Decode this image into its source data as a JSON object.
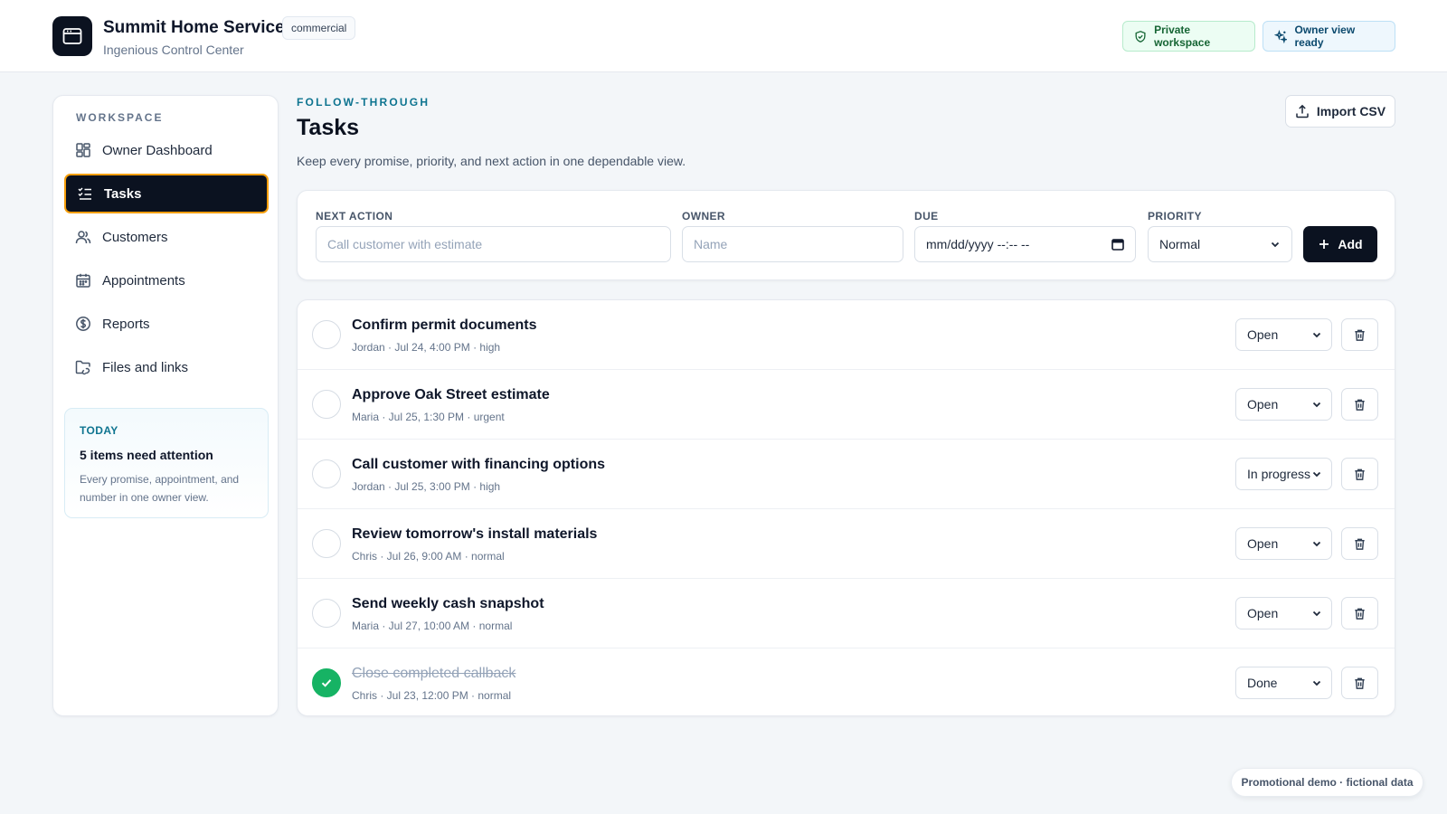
{
  "header": {
    "app_name": "Summit Home Services",
    "plan_badge": "commercial",
    "subtitle": "Ingenious Control Center",
    "private_label": "Private workspace",
    "owner_label": "Owner view ready",
    "icons": {
      "logo": "browser-window-icon",
      "private": "shield-check-icon",
      "owner": "sparkles-icon"
    }
  },
  "sidebar": {
    "heading": "WORKSPACE",
    "items": [
      {
        "label": "Owner Dashboard",
        "icon": "dashboard-grid-icon",
        "active": false
      },
      {
        "label": "Tasks",
        "icon": "checklist-icon",
        "active": true
      },
      {
        "label": "Customers",
        "icon": "users-icon",
        "active": false
      },
      {
        "label": "Appointments",
        "icon": "calendar-icon",
        "active": false
      },
      {
        "label": "Reports",
        "icon": "dollar-circle-icon",
        "active": false
      },
      {
        "label": "Files and links",
        "icon": "folder-link-icon",
        "active": false
      }
    ],
    "today": {
      "label": "TODAY",
      "title": "5 items need attention",
      "description": "Every promise, appointment, and number in one owner view."
    }
  },
  "main": {
    "eyebrow": "FOLLOW-THROUGH",
    "title": "Tasks",
    "description": "Keep every promise, priority, and next action in one dependable view.",
    "import_label": "Import CSV",
    "form": {
      "next_action_label": "NEXT ACTION",
      "next_action_placeholder": "Call customer with estimate",
      "owner_label": "OWNER",
      "owner_placeholder": "Name",
      "due_label": "DUE",
      "due_placeholder": "mm/dd/yyyy --:-- --",
      "priority_label": "PRIORITY",
      "priority_value": "Normal",
      "add_label": "Add"
    },
    "tasks": [
      {
        "title": "Confirm permit documents",
        "meta": "Jordan · Jul 24, 4:00 PM · high",
        "status": "Open",
        "done": false
      },
      {
        "title": "Approve Oak Street estimate",
        "meta": "Maria · Jul 25, 1:30 PM · urgent",
        "status": "Open",
        "done": false
      },
      {
        "title": "Call customer with financing options",
        "meta": "Jordan · Jul 25, 3:00 PM · high",
        "status": "In progress",
        "done": false
      },
      {
        "title": "Review tomorrow's install materials",
        "meta": "Chris · Jul 26, 9:00 AM · normal",
        "status": "Open",
        "done": false
      },
      {
        "title": "Send weekly cash snapshot",
        "meta": "Maria · Jul 27, 10:00 AM · normal",
        "status": "Open",
        "done": false
      },
      {
        "title": "Close completed callback",
        "meta": "Chris · Jul 23, 12:00 PM · normal",
        "status": "Done",
        "done": true
      }
    ]
  },
  "footer": {
    "badge": "Promotional demo · fictional data"
  },
  "colors": {
    "accent": "#0e7490",
    "dark": "#0b1220",
    "active_border": "#f59e0b",
    "done": "#16b364"
  }
}
